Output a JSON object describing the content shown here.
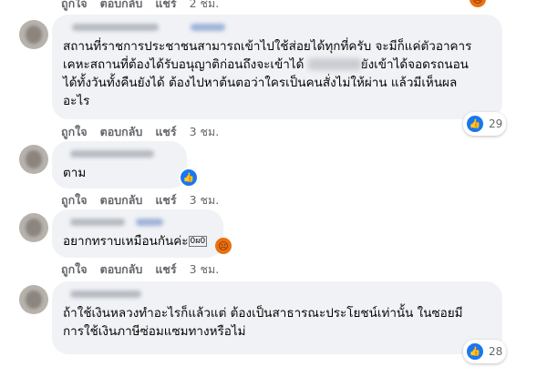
{
  "actions": {
    "like": "ถูกใจ",
    "reply": "ตอบกลับ",
    "share": "แชร์"
  },
  "top": {
    "time": "2 ชม."
  },
  "comments": [
    {
      "text_before": "สถานที่ราชการประชาชนสามารถเข้าไปใช้ส่อยได้ทุกที่ครับ จะมีก็แค่ตัวอาคาร\nเคหะสถานที่ต้องได้รับอนุญาติก่อนถึงจะเข้าได้ ",
      "text_after": "ยังเข้าได้จอดรถนอน\nได้ทั้งวันทั้งคืนยังได้ ต้องไปหาต้นตอว่าใครเป็นคนสั่งไม่ให้ผ่าน แล้วมีเห็นผล\nอะไร",
      "time": "3 ชม.",
      "reaction_count": "29"
    },
    {
      "text": "ตาม",
      "time": "3 ชม."
    },
    {
      "text": "อยากทราบเหมือนกันค่ะ",
      "sticker": "0ผ0",
      "time": "3 ชม."
    },
    {
      "text": "ถ้าใช้เงินหลวงทำอะไรก็แล้วแต่ ต้องเป็นสาธารณะประโยชน์เท่านั้น ในซอยมี\nการใช้เงินภาษีซ่อมแซมทางหรือไม่",
      "time": "3 ชม.",
      "reaction_count": "28"
    }
  ],
  "colors": {
    "bubble": "#f0f2f5",
    "meta": "#65676b",
    "like": "#1877f2",
    "angry": "#e9710f"
  }
}
